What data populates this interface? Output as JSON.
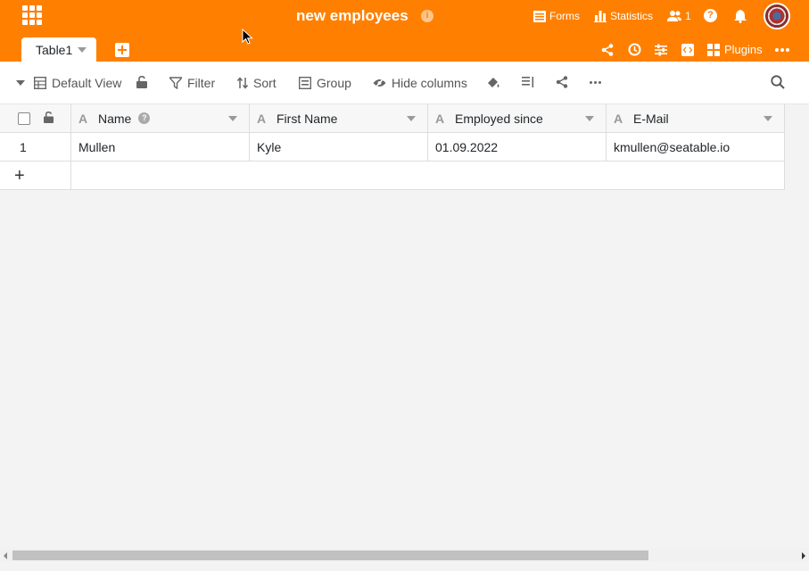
{
  "header": {
    "base_title": "new employees",
    "forms_label": "Forms",
    "statistics_label": "Statistics",
    "collaborators_count": "1",
    "help_symbol": "?",
    "info_symbol": "i",
    "plugins_label": "Plugins",
    "accent_color": "#ff8000"
  },
  "tabs": [
    {
      "label": "Table1"
    }
  ],
  "toolbar": {
    "view_label": "Default View",
    "filter_label": "Filter",
    "sort_label": "Sort",
    "group_label": "Group",
    "hide_columns_label": "Hide columns"
  },
  "table": {
    "columns": [
      {
        "name": "Name",
        "type_icon": "A"
      },
      {
        "name": "First Name",
        "type_icon": "A"
      },
      {
        "name": "Employed since",
        "type_icon": "A"
      },
      {
        "name": "E-Mail",
        "type_icon": "A"
      }
    ],
    "rows": [
      {
        "index": "1",
        "cells": [
          "Mullen",
          "Kyle",
          "01.09.2022",
          "kmullen@seatable.io"
        ]
      }
    ],
    "add_row_symbol": "+",
    "help_symbol": "?"
  }
}
